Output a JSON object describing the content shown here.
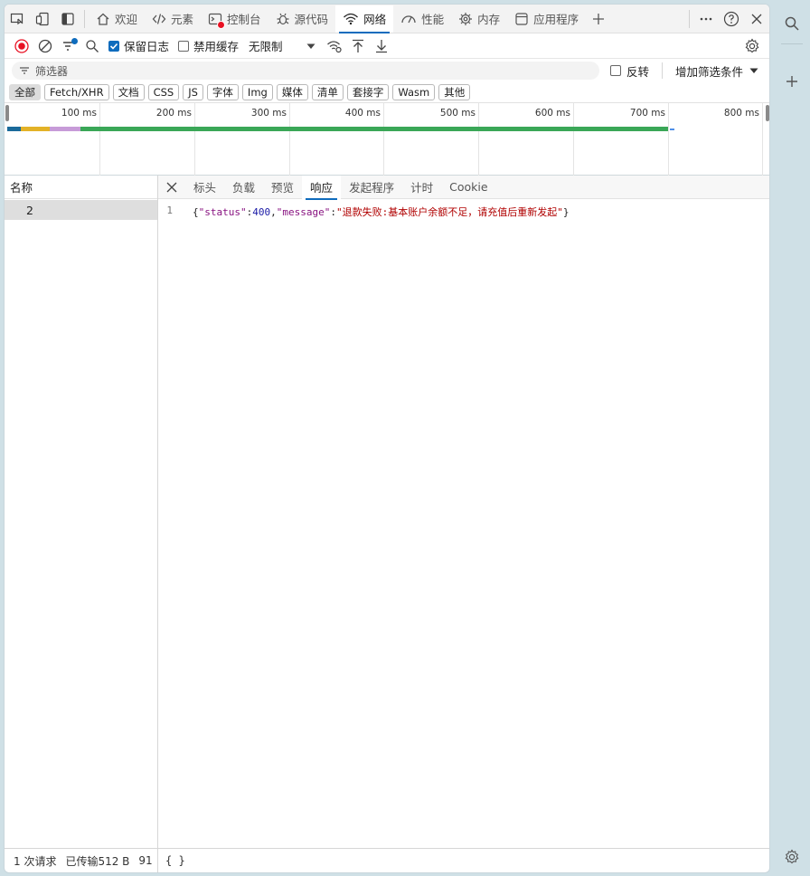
{
  "tabs": [
    {
      "label": "欢迎",
      "icon": "home-icon"
    },
    {
      "label": "元素",
      "icon": "code-icon"
    },
    {
      "label": "控制台",
      "icon": "console-icon"
    },
    {
      "label": "源代码",
      "icon": "bug-icon"
    },
    {
      "label": "网络",
      "icon": "wifi-icon",
      "active": true
    },
    {
      "label": "性能",
      "icon": "gauge-icon"
    },
    {
      "label": "内存",
      "icon": "chip-icon"
    },
    {
      "label": "应用程序",
      "icon": "app-icon"
    }
  ],
  "toolbar": {
    "preserve_log": "保留日志",
    "disable_cache": "禁用缓存",
    "throttle": "无限制"
  },
  "filter": {
    "placeholder": "筛选器",
    "invert": "反转",
    "add_filter": "增加筛选条件"
  },
  "chips": [
    "全部",
    "Fetch/XHR",
    "文档",
    "CSS",
    "JS",
    "字体",
    "Img",
    "媒体",
    "清单",
    "套接字",
    "Wasm",
    "其他"
  ],
  "overview": {
    "ticks": [
      "100 ms",
      "200 ms",
      "300 ms",
      "400 ms",
      "500 ms",
      "600 ms",
      "700 ms",
      "800 ms"
    ]
  },
  "left": {
    "header": "名称",
    "rows": [
      "2"
    ]
  },
  "detail_tabs": [
    "标头",
    "负载",
    "预览",
    "响应",
    "发起程序",
    "计时",
    "Cookie"
  ],
  "response": {
    "line_number": "1",
    "open_brace": "{",
    "key_status": "\"status\"",
    "colon1": ":",
    "value_status": "400",
    "comma": ",",
    "key_message": "\"message\"",
    "colon2": ":",
    "value_message": "\"退款失败:基本账户余额不足，请充值后重新发起\"",
    "close_brace": "}"
  },
  "status": {
    "requests": "1 次请求",
    "transferred": "已传输512 B",
    "extra": "91",
    "pretty_print": "{ }"
  },
  "colors": {
    "accent": "#0f6cbd",
    "record": "#e81123"
  }
}
